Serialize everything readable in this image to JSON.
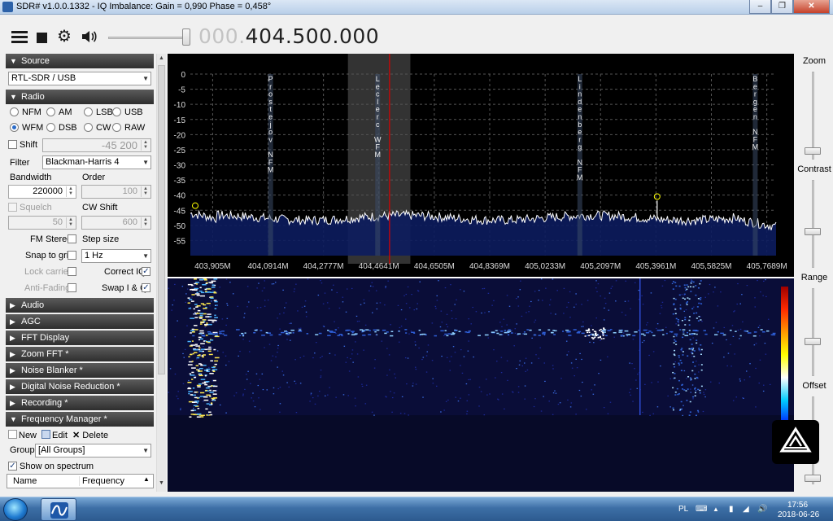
{
  "window": {
    "title": "SDR# v1.0.0.1332 - IQ Imbalance: Gain = 0,990 Phase = 0,458°"
  },
  "toolbar": {
    "freq_dim": "000.",
    "freq_main": "404.500.000"
  },
  "left": {
    "source": {
      "header": "Source",
      "device": "RTL-SDR / USB"
    },
    "radio": {
      "header": "Radio",
      "modes": [
        "NFM",
        "AM",
        "LSB",
        "USB",
        "WFM",
        "DSB",
        "CW",
        "RAW"
      ],
      "selected_mode": "WFM",
      "shift_label": "Shift",
      "shift_value": "-45 200",
      "filter_label": "Filter",
      "filter_value": "Blackman-Harris 4",
      "bandwidth_label": "Bandwidth",
      "bandwidth_value": "220000",
      "order_label": "Order",
      "order_value": "100",
      "squelch_label": "Squelch",
      "squelch_value": "50",
      "cwshift_label": "CW Shift",
      "cwshift_value": "600",
      "fmstereo_label": "FM Stereo",
      "stepsize_label": "Step size",
      "snap_label": "Snap to grid",
      "step_value": "1 Hz",
      "lockcarrier_label": "Lock carrier",
      "correctiq_label": "Correct IQ",
      "antifading_label": "Anti-Fading",
      "swapiq_label": "Swap I & Q"
    },
    "collapsed": [
      "Audio",
      "AGC",
      "FFT Display",
      "Zoom FFT *",
      "Noise Blanker *",
      "Digital Noise Reduction *",
      "Recording *"
    ],
    "freqmgr": {
      "header": "Frequency Manager *",
      "new": "New",
      "edit": "Edit",
      "delete": "Delete",
      "group_label": "Group:",
      "group_value": "[All Groups]",
      "show_on_spectrum": "Show on spectrum",
      "col_name": "Name",
      "col_freq": "Frequency"
    }
  },
  "right": {
    "zoom": "Zoom",
    "contrast": "Contrast",
    "range": "Range",
    "offset": "Offset"
  },
  "spectrum": {
    "y_ticks": [
      "0",
      "-5",
      "-10",
      "-15",
      "-20",
      "-25",
      "-30",
      "-35",
      "-40",
      "-45",
      "-50",
      "-55"
    ],
    "x_ticks": [
      "403,905M",
      "404,0914M",
      "404,2777M",
      "404,4641M",
      "404,6505M",
      "404,8369M",
      "405,0233M",
      "405,2097M",
      "405,3961M",
      "405,5825M",
      "405,7689M"
    ],
    "markers": [
      {
        "label": "Prostejov NFM",
        "freq": 404.1
      },
      {
        "label": "Leclerc WFM",
        "freq": 404.46
      },
      {
        "label": "Lindenberg NFM",
        "freq": 405.14
      },
      {
        "label": "Bergen NFM",
        "freq": 405.73
      }
    ]
  },
  "taskbar": {
    "lang": "PL",
    "time": "17:56",
    "date": "2018-06-26"
  }
}
